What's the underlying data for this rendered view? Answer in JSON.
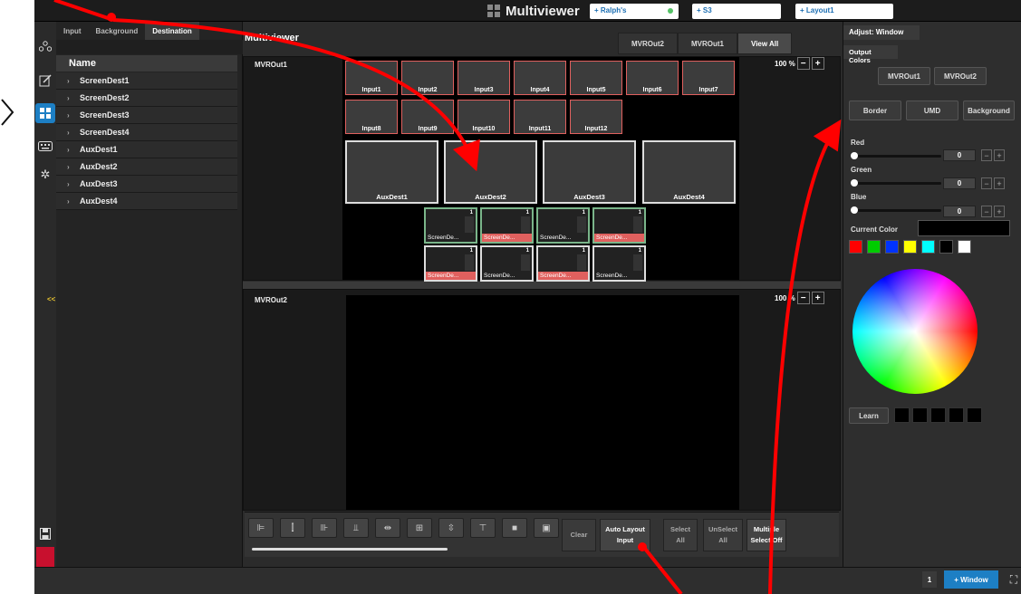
{
  "topbar": {
    "title": "Multiviewer",
    "dropdowns": [
      "+ Ralph's",
      "+ S3",
      "+ Layout1"
    ]
  },
  "dest_panel": {
    "tabs": [
      "Input",
      "Background",
      "Destination"
    ],
    "header": "Name",
    "items": [
      "ScreenDest1",
      "ScreenDest2",
      "ScreenDest3",
      "ScreenDest4",
      "AuxDest1",
      "AuxDest2",
      "AuxDest3",
      "AuxDest4"
    ],
    "collapse": "<<"
  },
  "canvas": {
    "title": "Multiviewer",
    "tabs": [
      "MVROut2",
      "MVROut1",
      "View All"
    ],
    "out1": {
      "label": "MVROut1",
      "zoom": "100 %",
      "inputs_row1": [
        "Input1",
        "Input2",
        "Input3",
        "Input4",
        "Input5",
        "Input6",
        "Input7"
      ],
      "inputs_row2": [
        "Input8",
        "Input9",
        "Input10",
        "Input11",
        "Input12"
      ],
      "aux": [
        "AuxDest1",
        "AuxDest2",
        "AuxDest3",
        "AuxDest4"
      ],
      "screens": [
        {
          "name": "ScreenDe...",
          "num": "1",
          "highlight": false
        },
        {
          "name": "ScreenDe...",
          "num": "1",
          "highlight": true
        },
        {
          "name": "ScreenDe...",
          "num": "1",
          "highlight": false
        },
        {
          "name": "ScreenDe...",
          "num": "1",
          "highlight": true
        },
        {
          "name": "ScreenDe...",
          "num": "1",
          "highlight": true
        },
        {
          "name": "ScreenDe...",
          "num": "1",
          "highlight": false
        },
        {
          "name": "ScreenDe...",
          "num": "1",
          "highlight": true
        },
        {
          "name": "ScreenDe...",
          "num": "1",
          "highlight": false
        }
      ]
    },
    "out2": {
      "label": "MVROut2",
      "zoom": "100 %"
    }
  },
  "toolbar": {
    "icons": [
      "align-left-icon",
      "align-center-v-icon",
      "align-right-icon",
      "align-bottom-icon",
      "distribute-h-icon",
      "grid-icon",
      "distribute-v-icon",
      "align-top-icon",
      "fill-icon",
      "fit-icon"
    ],
    "clear": "Clear",
    "auto_layout": [
      "Auto Layout",
      "Input"
    ],
    "select_all": [
      "Select",
      "All"
    ],
    "unselect_all": [
      "UnSelect",
      "All"
    ],
    "multiple": [
      "Multiple",
      "Select Off"
    ]
  },
  "adjust": {
    "title": "Adjust: Window",
    "section": "Output Colors",
    "outputs": [
      "MVROut1",
      "MVROut2"
    ],
    "targets": [
      "Border",
      "UMD",
      "Background"
    ],
    "channels": [
      {
        "label": "Red",
        "value": "0"
      },
      {
        "label": "Green",
        "value": "0"
      },
      {
        "label": "Blue",
        "value": "0"
      }
    ],
    "current_color_label": "Current Color",
    "swatches": [
      "#ff0000",
      "#00cc00",
      "#0033ff",
      "#ffff00",
      "#00ffff",
      "#000000",
      "#ffffff"
    ],
    "learn": "Learn"
  },
  "bottom": {
    "page": "1",
    "add_window": "+ Window"
  }
}
